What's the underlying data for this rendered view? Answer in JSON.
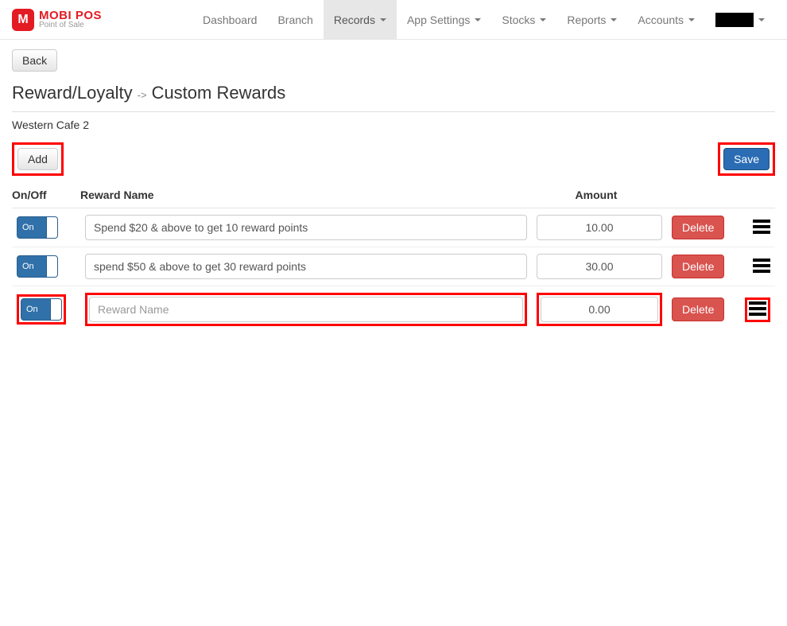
{
  "brand": {
    "name": "MOBI POS",
    "sub": "Point of Sale",
    "logo_letter": "M"
  },
  "nav": {
    "dashboard": "Dashboard",
    "branch": "Branch",
    "records": "Records",
    "app_settings": "App Settings",
    "stocks": "Stocks",
    "reports": "Reports",
    "accounts": "Accounts"
  },
  "back_label": "Back",
  "title_main": "Reward/Loyalty",
  "title_arrow": "->",
  "title_sub": "Custom Rewards",
  "branch_name": "Western Cafe 2",
  "add_label": "Add",
  "save_label": "Save",
  "headers": {
    "onoff": "On/Off",
    "name": "Reward Name",
    "amount": "Amount"
  },
  "toggle_on": "On",
  "delete_label": "Delete",
  "name_placeholder": "Reward Name",
  "rows": [
    {
      "on": true,
      "name": "Spend $20 & above to get 10 reward points",
      "amount": "10.00",
      "highlighted": false
    },
    {
      "on": true,
      "name": "spend $50 & above to get 30 reward points",
      "amount": "30.00",
      "highlighted": false
    },
    {
      "on": true,
      "name": "",
      "amount": "0.00",
      "highlighted": true
    }
  ],
  "colors": {
    "brand_red": "#e31b23",
    "primary_blue": "#3071a9",
    "danger": "#d9534f",
    "highlight": "#ff0000"
  }
}
